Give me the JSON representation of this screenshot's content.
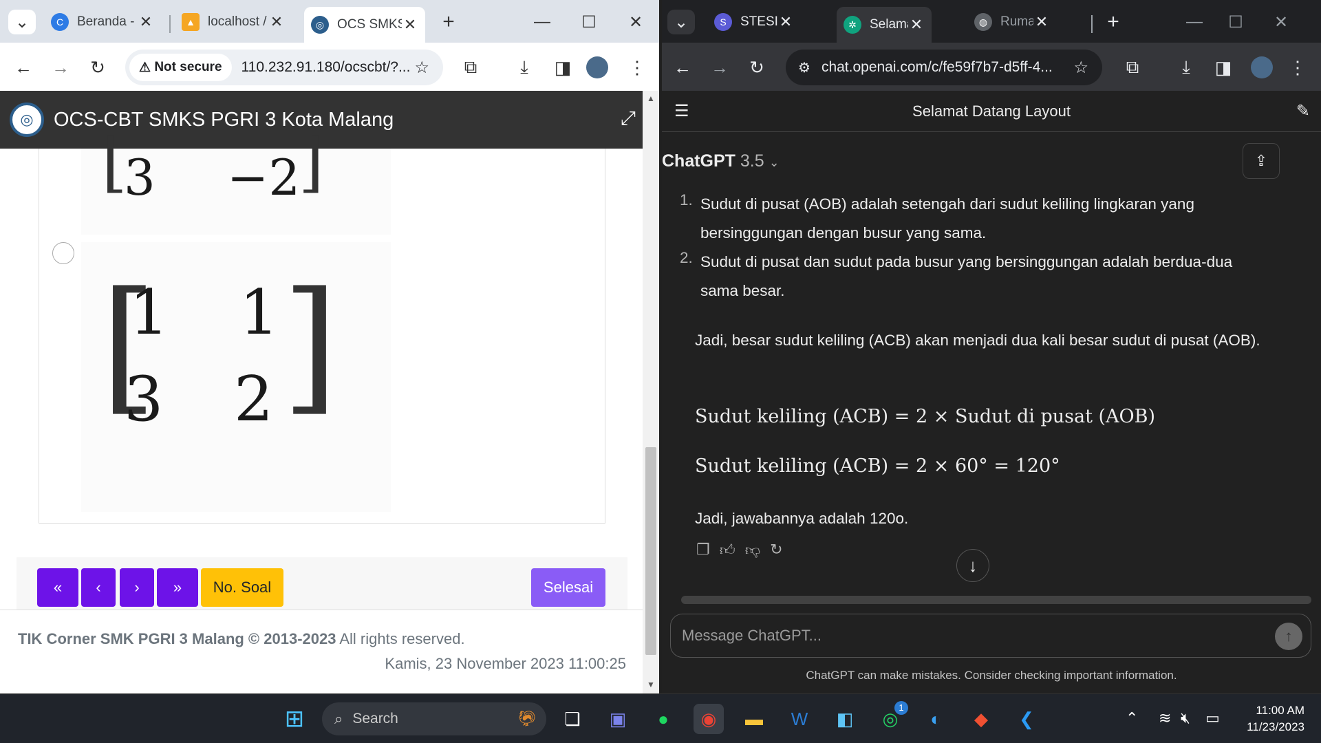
{
  "left_browser": {
    "tabs": [
      {
        "icon": "chrome-icon",
        "label": "Beranda -"
      },
      {
        "icon": "pma-icon",
        "label": "localhost /"
      },
      {
        "icon": "ocs-icon",
        "label": "OCS SMKS"
      }
    ],
    "address": {
      "security": "Not secure",
      "url": "110.232.91.180/ocscbt/?..."
    },
    "app_title": "OCS-CBT SMKS PGRI 3 Kota Malang",
    "matrix_partial": {
      "left": "3",
      "right": "−2"
    },
    "matrix_option": {
      "r1c1": "1",
      "r1c2": "1",
      "r2c1": "3",
      "r2c2": "2"
    },
    "nav": {
      "first": "«",
      "prev": "‹",
      "next": "›",
      "last": "»",
      "soal": "No. Soal",
      "finish": "Selesai"
    },
    "footer": {
      "org": "TIK Corner SMK PGRI 3 Malang © 2013-2023",
      "rights": "All rights reserved.",
      "date": "Kamis, 23 November 2023 11:00:25"
    },
    "colors": {
      "primary": "#6d13e8",
      "warning": "#ffc107",
      "finish": "#8a5cf6"
    }
  },
  "right_browser": {
    "tabs": [
      {
        "icon": "stesil-icon",
        "label": "STESIL RS"
      },
      {
        "icon": "openai-icon",
        "label": "Selamat D"
      },
      {
        "icon": "globe-icon",
        "label": "Rumah Sa"
      }
    ],
    "address": {
      "url": "chat.openai.com/c/fe59f7b7-d5ff-4..."
    },
    "chat_title": "Selamat Datang Layout",
    "model": {
      "name": "ChatGPT",
      "version": "3.5"
    },
    "list_items": [
      {
        "n": "1.",
        "text": "Sudut di pusat (AOB) adalah setengah dari sudut keliling lingkaran yang bersinggungan dengan busur yang sama."
      },
      {
        "n": "2.",
        "text": "Sudut di pusat dan sudut pada busur yang bersinggungan adalah berdua-dua sama besar."
      }
    ],
    "paragraph": "Jadi, besar sudut keliling (ACB) akan menjadi dua kali besar sudut di pusat (AOB).",
    "math1": "Sudut keliling (ACB) = 2 × Sudut di pusat (AOB)",
    "math2": "Sudut keliling (ACB) = 2 × 60° = 120°",
    "answer": "Jadi, jawabannya adalah 120o.",
    "input_placeholder": "Message ChatGPT...",
    "disclaimer": "ChatGPT can make mistakes. Consider checking important information."
  },
  "taskbar": {
    "search": "Search",
    "time": "11:00 AM",
    "date": "11/23/2023",
    "whatsapp_badge": "1"
  }
}
